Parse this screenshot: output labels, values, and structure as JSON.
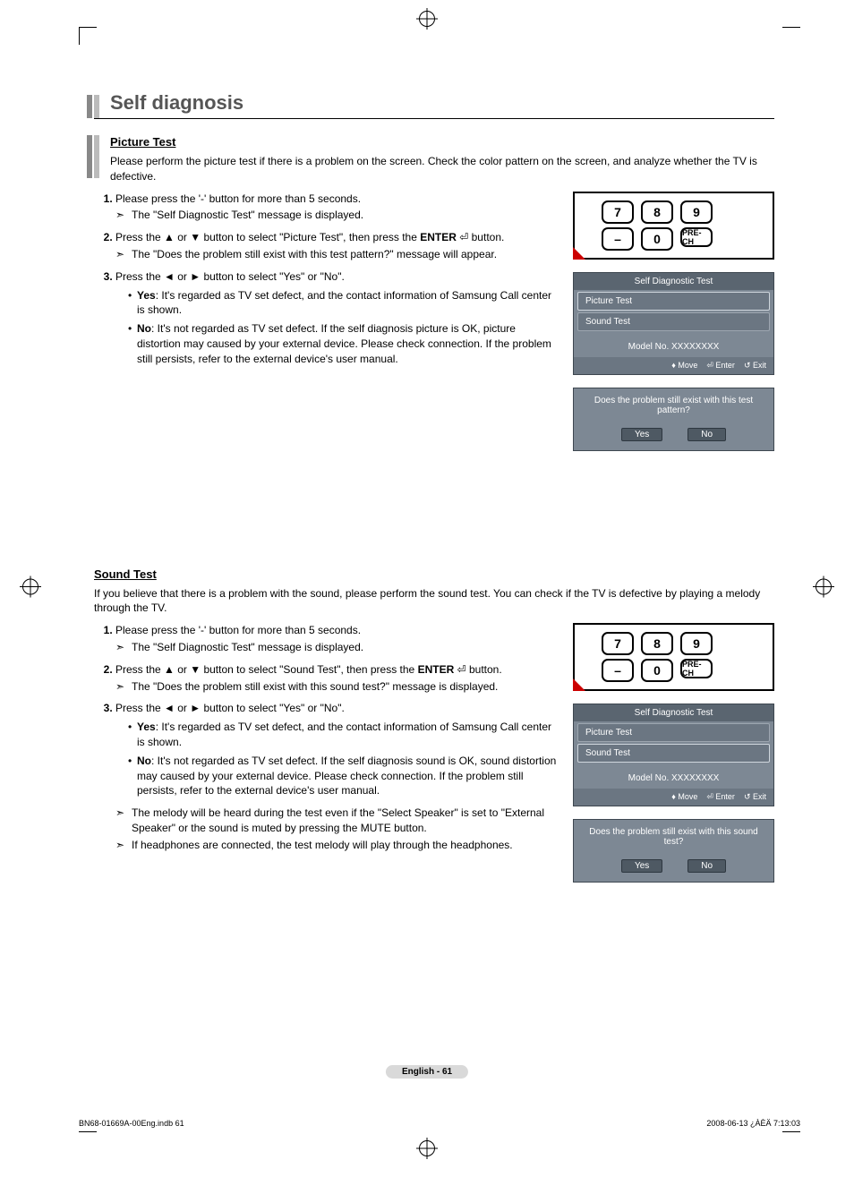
{
  "header": {
    "title": "Self diagnosis"
  },
  "picture": {
    "sub_title": "Picture Test",
    "intro": "Please perform the picture test if there is a problem on the screen. Check the color pattern on the screen, and analyze whether the TV is defective.",
    "step1": "Please press the '-' button for more than 5 seconds.",
    "step1_note": "The \"Self Diagnostic Test\" message is displayed.",
    "step2_a": "Press the ▲ or ▼ button to select \"Picture Test\", then press the ",
    "step2_enter": "ENTER",
    "step2_b": " button.",
    "step2_note": "The \"Does the problem still exist with this test pattern?\" message will appear.",
    "step3": "Press the ◄ or ► button to select \"Yes\" or \"No\".",
    "yes_label": "Yes",
    "yes_text": ": It's regarded as TV set defect, and the contact information of Samsung Call center is shown.",
    "no_label": "No",
    "no_text": ": It's not regarded as TV set defect. If the self diagnosis picture is OK, picture distortion may caused by your external device. Please check connection. If the problem still persists, refer to the external device's user manual."
  },
  "sound": {
    "sub_title": "Sound Test",
    "intro": "If you believe that there is a problem with the sound, please perform the sound test. You can check if the TV is defective by playing a melody through the TV.",
    "step1": "Please press the '-' button for more than 5 seconds.",
    "step1_note": "The \"Self Diagnostic Test\" message is displayed.",
    "step2_a": "Press the ▲ or ▼ button to select \"Sound Test\", then press the ",
    "step2_enter": "ENTER",
    "step2_b": " button.",
    "step2_note": "The \"Does the problem still exist with this sound test?\" message is displayed.",
    "step3": "Press the ◄ or ► button to select \"Yes\" or \"No\".",
    "yes_label": "Yes",
    "yes_text": ": It's regarded as TV set defect, and the contact information of Samsung Call center is shown.",
    "no_label": "No",
    "no_text": ": It's not regarded as TV set defect. If the self diagnosis sound is OK, sound distortion may caused by your external device. Please check connection. If the problem still persists, refer to the external device's user manual.",
    "extra1": "The melody will be heard during the test even if the \"Select Speaker\" is set to \"External Speaker\" or the sound is muted by pressing the MUTE button.",
    "extra2": "If headphones are connected, the test melody will play through the headphones."
  },
  "remote": {
    "b7": "7",
    "b8": "8",
    "b9": "9",
    "bdash": "–",
    "b0": "0",
    "bpre": "PRE-CH"
  },
  "osd": {
    "title": "Self Diagnostic Test",
    "item1": "Picture Test",
    "item2": "Sound Test",
    "model": "Model No. XXXXXXXX",
    "move": "Move",
    "enter": "Enter",
    "exit": "Exit"
  },
  "prompt_pic": {
    "q": "Does the problem still exist with this test pattern?",
    "yes": "Yes",
    "no": "No"
  },
  "prompt_snd": {
    "q": "Does the problem still exist with this sound test?",
    "yes": "Yes",
    "no": "No"
  },
  "footer": {
    "page_label": "English - 61",
    "left": "BN68-01669A-00Eng.indb   61",
    "right": "2008-06-13   ¿ÀÈÄ 7:13:03"
  }
}
